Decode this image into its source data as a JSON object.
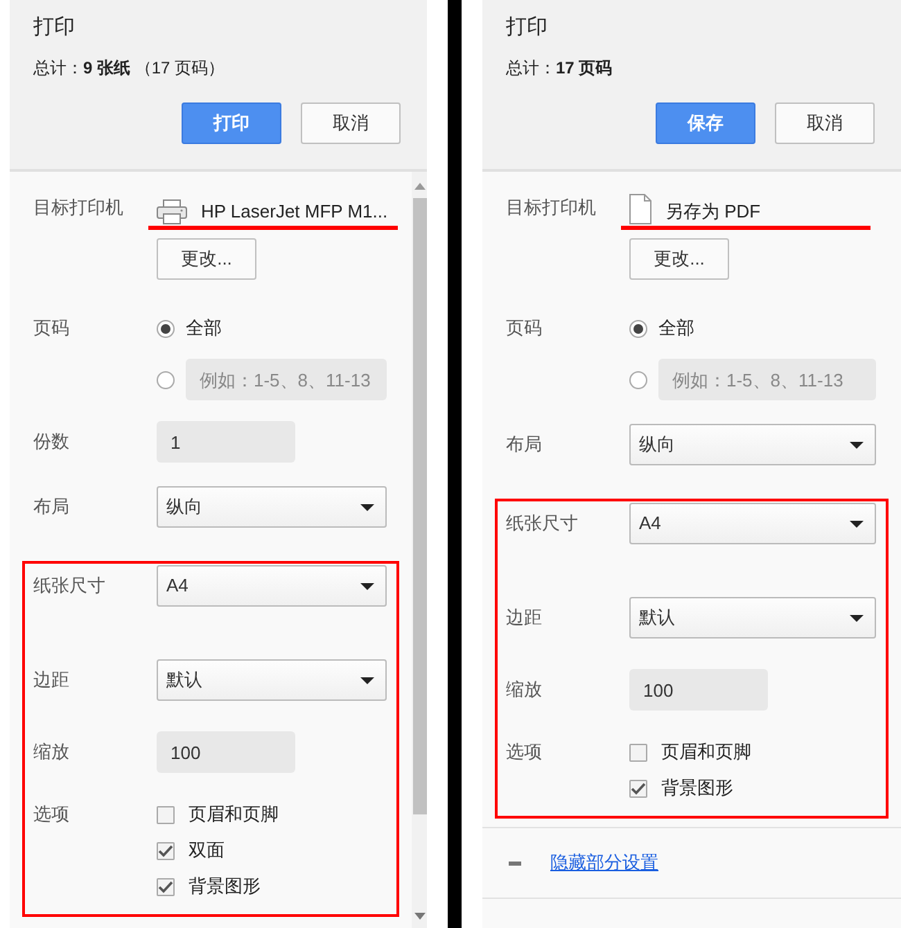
{
  "panels": [
    {
      "title": "打印",
      "total": "总计：**9 张纸** （17 页码）",
      "scrollbar": true,
      "buttons": [
        {
          "label": "打印",
          "kind": "primary"
        },
        {
          "label": "取消",
          "kind": "secondary"
        }
      ],
      "settings": [
        {
          "kind": "printer_destination",
          "label": "目标打印机",
          "name": "HP LaserJet MFP M1...",
          "button": "更改..."
        },
        {
          "kind": "pages",
          "label": "页码",
          "options": [
            {
              "label": "全部",
              "selected": true
            },
            {
              "placeholder": "例如：1-5、8、11-13",
              "selected": false
            }
          ]
        },
        {
          "kind": "input",
          "label": "份数",
          "value": "1"
        },
        {
          "kind": "select",
          "label": "布局",
          "value": "纵向"
        }
      ],
      "highlighted_settings": [
        {
          "kind": "select",
          "label": "纸张尺寸",
          "value": "A4"
        },
        {
          "kind": "select",
          "label": "边距",
          "value": "默认"
        },
        {
          "kind": "input",
          "label": "缩放",
          "value": "100"
        },
        {
          "kind": "checkboxes",
          "label": "选项",
          "options": [
            {
              "label": "页眉和页脚",
              "checked": false
            },
            {
              "label": "双面",
              "checked": true
            },
            {
              "label": "背景图形",
              "checked": true
            }
          ]
        }
      ]
    },
    {
      "title": "打印",
      "total": "总计：**17 页码**",
      "buttons": [
        {
          "label": "保存",
          "kind": "primary"
        },
        {
          "label": "取消",
          "kind": "secondary"
        }
      ],
      "settings": [
        {
          "kind": "pdf_destination",
          "label": "目标打印机",
          "name": "另存为 PDF",
          "button": "更改..."
        },
        {
          "kind": "pages",
          "label": "页码",
          "options": [
            {
              "label": "全部",
              "selected": true
            },
            {
              "placeholder": "例如：1-5、8、11-13",
              "selected": false
            }
          ]
        },
        {
          "kind": "select",
          "label": "布局",
          "value": "纵向"
        }
      ],
      "highlighted_settings": [
        {
          "kind": "select",
          "label": "纸张尺寸",
          "value": "A4"
        },
        {
          "kind": "select",
          "label": "边距",
          "value": "默认"
        },
        {
          "kind": "input",
          "label": "缩放",
          "value": "100"
        },
        {
          "kind": "checkboxes",
          "label": "选项",
          "options": [
            {
              "label": "页眉和页脚",
              "checked": false
            },
            {
              "label": "背景图形",
              "checked": true
            }
          ]
        }
      ],
      "toggle_link": "隐藏部分设置"
    }
  ]
}
